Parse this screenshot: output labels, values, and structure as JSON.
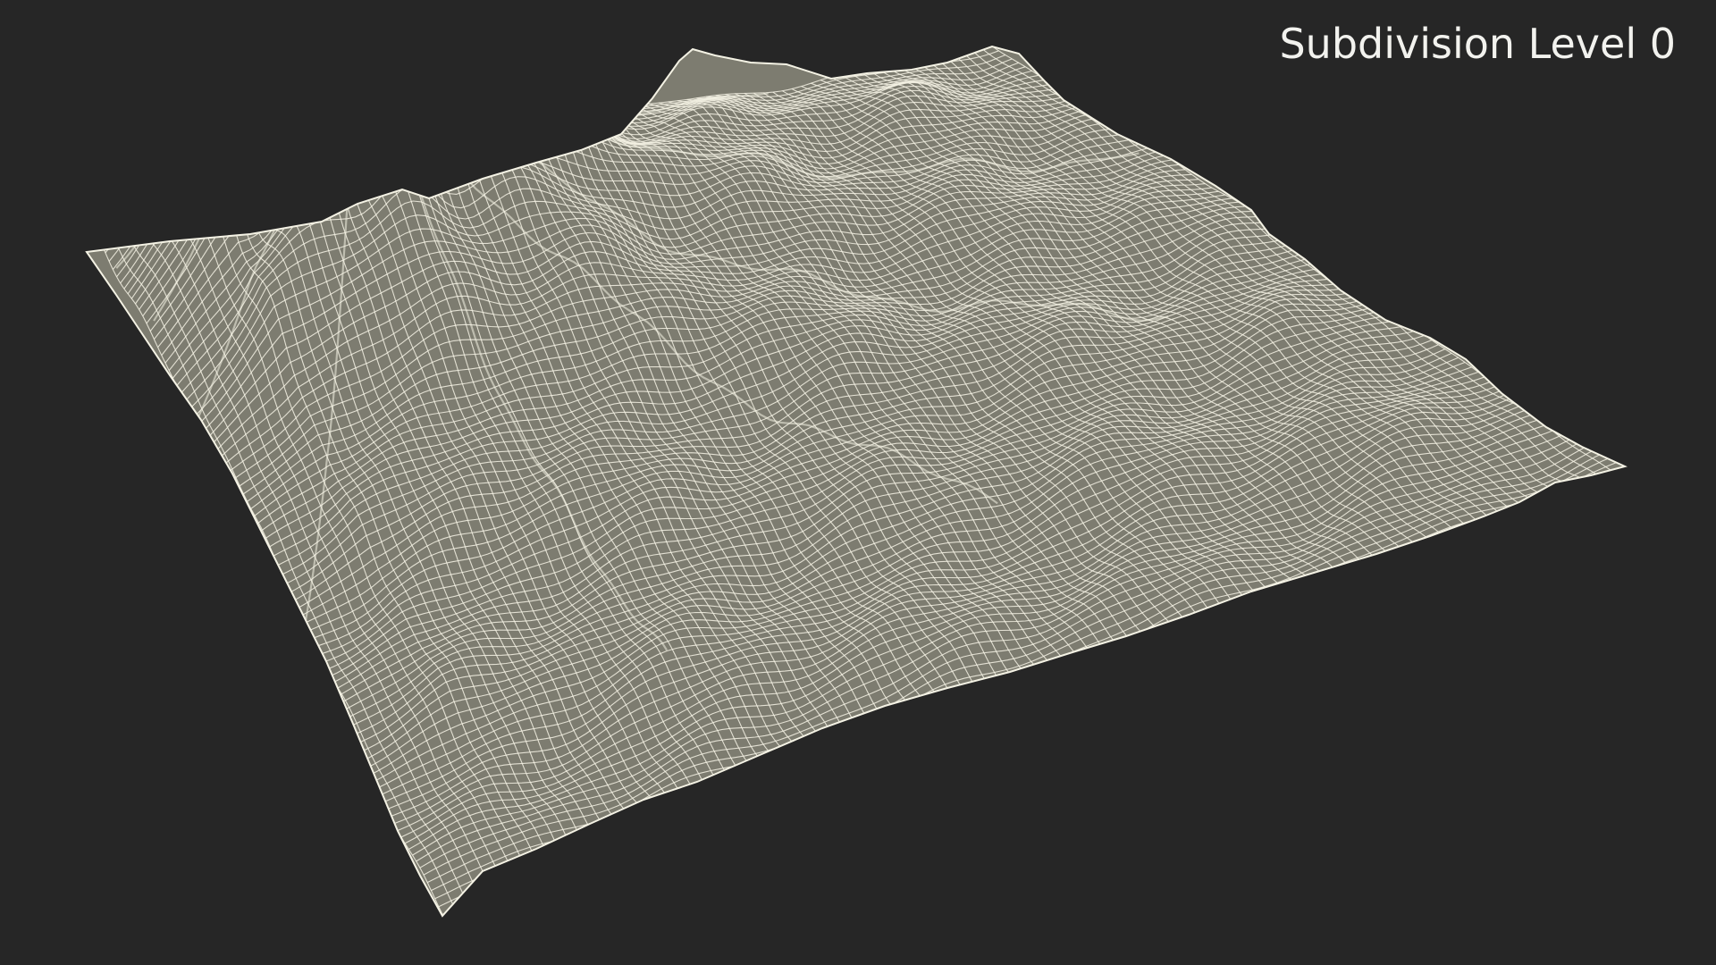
{
  "viewport": {
    "label": "Subdivision Level 0",
    "background_color": "#262626"
  },
  "model": {
    "subject": "volcano terrain",
    "render_mode": "wireframe",
    "surface_color": "#7d7c70",
    "wire_color": "#f4f2e4"
  }
}
